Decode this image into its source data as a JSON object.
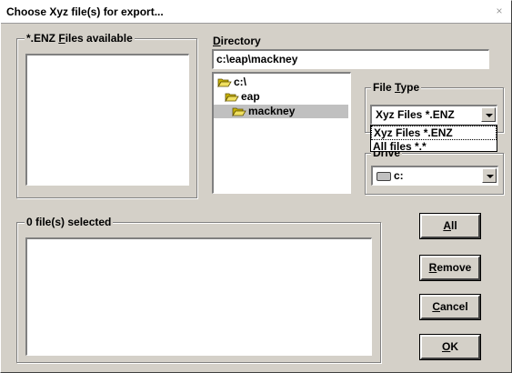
{
  "window": {
    "title": "Choose Xyz file(s) for export...",
    "close_glyph": "×"
  },
  "files_group": {
    "label_pre": "*.ENZ ",
    "label_accel": "F",
    "label_post": "iles available"
  },
  "directory": {
    "label_accel": "D",
    "label_post": "irectory",
    "path": "c:\\eap\\mackney",
    "tree": [
      {
        "name": "c:\\",
        "level": 0,
        "selected": false
      },
      {
        "name": "eap",
        "level": 1,
        "selected": false
      },
      {
        "name": "mackney",
        "level": 2,
        "selected": true
      }
    ]
  },
  "file_type": {
    "label_pre": "File ",
    "label_accel": "T",
    "label_post": "ype",
    "selected": "Xyz Files  *.ENZ",
    "options": [
      "Xyz Files  *.ENZ",
      "All files  *.*"
    ]
  },
  "drive": {
    "label_partial": "Drive",
    "selected": "c:",
    "icon": "drive-icon"
  },
  "selected_group": {
    "label": "0 file(s) selected"
  },
  "buttons": {
    "all": {
      "accel": "A",
      "rest": "ll"
    },
    "remove": {
      "accel": "R",
      "rest": "emove"
    },
    "cancel": {
      "accel": "C",
      "rest": "ancel"
    },
    "ok": {
      "accel": "O",
      "rest": "K"
    }
  },
  "colors": {
    "face": "#d4d0c8",
    "highlight": "#c0c0c0"
  }
}
